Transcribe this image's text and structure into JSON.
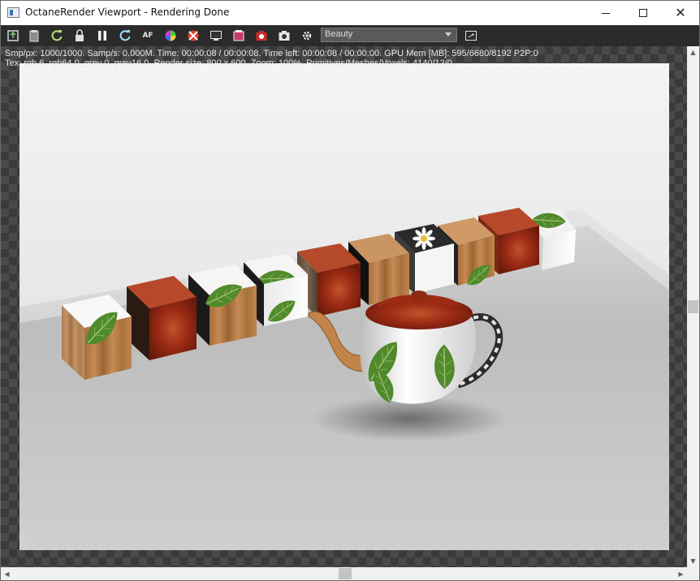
{
  "window": {
    "title": "OctaneRender Viewport - Rendering Done",
    "controls": {
      "minimize": "–",
      "maximize": "□",
      "close": "✕"
    }
  },
  "toolbar": {
    "buttons": [
      {
        "name": "export-icon"
      },
      {
        "name": "clipboard-icon"
      },
      {
        "name": "restart-render-icon"
      },
      {
        "name": "lock-icon"
      },
      {
        "name": "pause-icon"
      },
      {
        "name": "refresh-icon"
      },
      {
        "name": "af-icon",
        "label": "AF"
      },
      {
        "name": "color-picker-icon"
      },
      {
        "name": "region-render-icon"
      },
      {
        "name": "display-icon"
      },
      {
        "name": "film-icon"
      },
      {
        "name": "camera-red-icon"
      },
      {
        "name": "camera-icon"
      },
      {
        "name": "settings-gear-icon"
      }
    ],
    "pass_select": {
      "value": "Beauty"
    }
  },
  "stats": {
    "line1": "Smp/px: 1000/1000.   Samp/s: 0.000M.   Time: 00:00:08 / 00:00:08.   Time left: 00:00:08 / 00:00:00.   GPU Mem [MB]: 595/6680/8192 P2P:0",
    "line2": "Tex: rgb 6, rgb64 0, grey 0, grey16 0.   Render size: 800 x 600.   Zoom: 100%.   Primitives/Meshes/Voxels: 4140/12/0"
  },
  "colors": {
    "leaf": "#4f8a2b",
    "wood": "#b07a45",
    "red_texture": "#9c2b14",
    "floor": "#c9c9c9",
    "backdrop": "#ececec"
  }
}
